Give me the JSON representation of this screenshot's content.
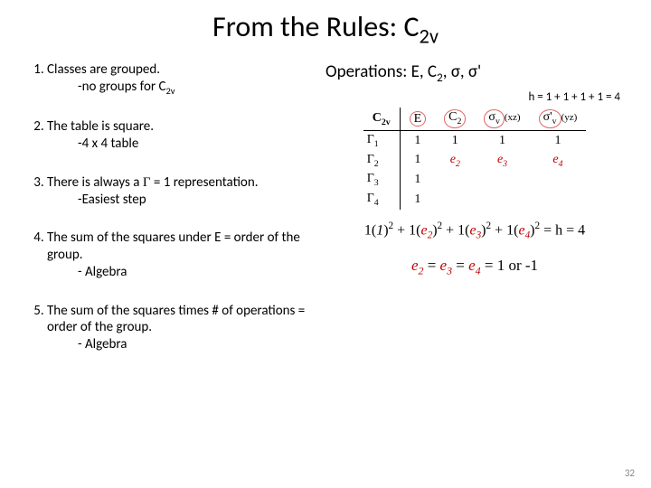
{
  "title_pre": "From the Rules: C",
  "title_sub": "2v",
  "rules": [
    {
      "main": "Classes are grouped.",
      "sub_pre": "-no groups for C",
      "sub_sub": "2v"
    },
    {
      "main": "The table is square.",
      "sub": "-4 x 4 table"
    },
    {
      "main_pre": "There is always a ",
      "main_sym": "Γ",
      "main_post": " = 1 representation.",
      "sub": "-Easiest step"
    },
    {
      "main": "The sum of the squares under E = order of the group.",
      "sub": "- Algebra"
    },
    {
      "main": "The sum of the squares times # of operations = order of the group.",
      "sub": "- Algebra"
    }
  ],
  "ops_pre": "Operations: E, C",
  "ops_sub": "2",
  "ops_post": ", σ, σ'",
  "heq": "h = 1 + 1 + 1 + 1 = 4",
  "table": {
    "corner_pre": "C",
    "corner_sub": "2v",
    "h_E": "E",
    "h_C2_pre": "C",
    "h_C2_sub": "2",
    "h_sv_pre": "σ",
    "h_sv_sub": "v",
    "h_sv_par": "(xz)",
    "h_svp_pre": "σ'",
    "h_svp_sub": "v",
    "h_svp_par": "(yz)",
    "rows": [
      {
        "label_pre": "Γ",
        "label_sub": "1",
        "c1": "1",
        "c2": "1",
        "c3": "1",
        "c4": "1"
      },
      {
        "label_pre": "Γ",
        "label_sub": "2",
        "c1": "1",
        "c2_sub": "2",
        "c3_sub": "3",
        "c4_sub": "4"
      },
      {
        "label_pre": "Γ",
        "label_sub": "3",
        "c1": "1"
      },
      {
        "label_pre": "Γ",
        "label_sub": "4",
        "c1": "1"
      }
    ]
  },
  "eq1": {
    "t1": "1(",
    "i1": "1",
    "t2": ")",
    "sup": "2",
    "t3": " + 1(",
    "e2": "e",
    "e2s": "2",
    "t4": ")",
    "t5": " + 1(",
    "e3": "e",
    "e3s": "3",
    "t6": ")",
    "t7": " + 1(",
    "e4": "e",
    "e4s": "4",
    "t8": ")",
    "rhs": " = h = 4"
  },
  "eq2": {
    "e": "e",
    "s2": "2",
    "eq": " = ",
    "s3": "3",
    "s4": "4",
    "rhs": " =  1 or -1"
  },
  "pagenum": "32"
}
